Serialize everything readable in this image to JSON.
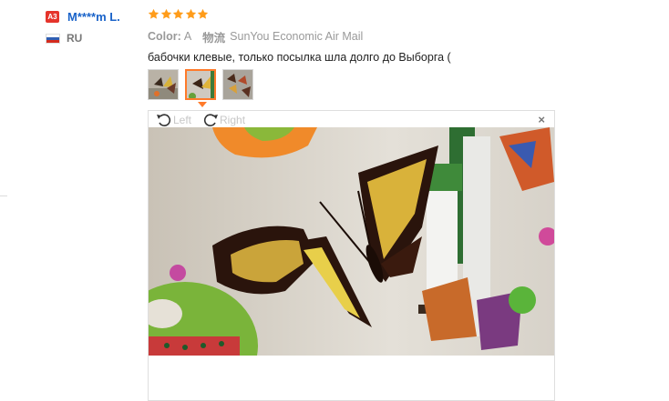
{
  "user": {
    "badge": "A3",
    "name": "M****m L.",
    "country": "RU",
    "flag_colors": [
      "#ffffff",
      "#2f5fb3",
      "#d52b1e"
    ]
  },
  "review": {
    "rating": 5,
    "star_color": "#ff9c1a",
    "color_label": "Color:",
    "color_value": "A",
    "shipping_label": "物流",
    "shipping_value": "SunYou Economic Air Mail",
    "text": "бабочки клевые, только посылка шла долго до Выборга ("
  },
  "gallery": {
    "thumbnails": [
      {
        "name": "photo-1"
      },
      {
        "name": "photo-2",
        "active": true
      },
      {
        "name": "photo-3"
      }
    ],
    "accent_color": "#ff7a2a"
  },
  "viewer": {
    "rotate_left_label": "Left",
    "rotate_right_label": "Right",
    "close_icon": "×"
  }
}
